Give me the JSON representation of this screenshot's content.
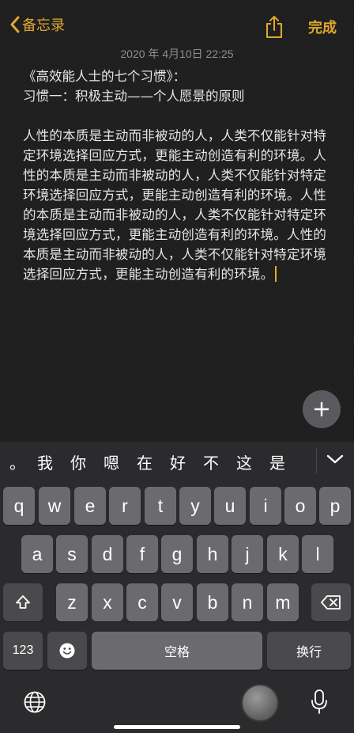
{
  "nav": {
    "back_label": "备忘录",
    "done_label": "完成"
  },
  "note": {
    "date": "2020 年 4月10日 22:25",
    "title_line1": "《高效能人士的七个习惯》：",
    "title_line2": "习惯一：积极主动——个人愿景的原则",
    "body": "人性的本质是主动而非被动的人，人类不仅能针对特定环境选择回应方式，更能主动创造有利的环境。人性的本质是主动而非被动的人，人类不仅能针对特定环境选择回应方式，更能主动创造有利的环境。人性的本质是主动而非被动的人，人类不仅能针对特定环境选择回应方式，更能主动创造有利的环境。人性的本质是主动而非被动的人，人类不仅能针对特定环境选择回应方式，更能主动创造有利的环境。"
  },
  "candidates": [
    "。",
    "我",
    "你",
    "嗯",
    "在",
    "好",
    "不",
    "这",
    "是"
  ],
  "keyboard": {
    "row1": [
      "q",
      "w",
      "e",
      "r",
      "t",
      "y",
      "u",
      "i",
      "o",
      "p"
    ],
    "row2": [
      "a",
      "s",
      "d",
      "f",
      "g",
      "h",
      "j",
      "k",
      "l"
    ],
    "row3": [
      "z",
      "x",
      "c",
      "v",
      "b",
      "n",
      "m"
    ],
    "numbers_label": "123",
    "space_label": "空格",
    "return_label": "换行"
  },
  "colors": {
    "accent": "#e0a82e",
    "key": "#6b6b6e",
    "key_dark": "#4a4a4d",
    "keyboard_bg": "#2b2b2d"
  },
  "icons": {
    "back": "chevron-left-icon",
    "share": "share-icon",
    "plus": "plus-icon",
    "collapse": "chevron-down-icon",
    "shift": "shift-icon",
    "delete": "delete-icon",
    "emoji": "emoji-icon",
    "globe": "globe-icon",
    "mic": "microphone-icon"
  }
}
